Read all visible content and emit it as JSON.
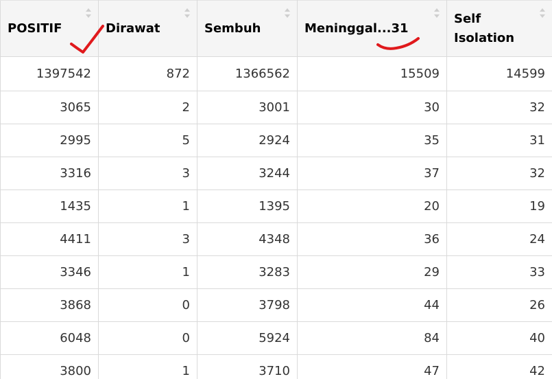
{
  "table": {
    "columns": [
      {
        "label": "POSITIF"
      },
      {
        "label": "Dirawat"
      },
      {
        "label": "Sembuh"
      },
      {
        "label": "Meninggal...31"
      },
      {
        "label": "Self Isolation"
      }
    ],
    "rows": [
      [
        "1397542",
        "872",
        "1366562",
        "15509",
        "14599"
      ],
      [
        "3065",
        "2",
        "3001",
        "30",
        "32"
      ],
      [
        "2995",
        "5",
        "2924",
        "35",
        "31"
      ],
      [
        "3316",
        "3",
        "3244",
        "37",
        "32"
      ],
      [
        "1435",
        "1",
        "1395",
        "20",
        "19"
      ],
      [
        "4411",
        "3",
        "4348",
        "36",
        "24"
      ],
      [
        "3346",
        "1",
        "3283",
        "29",
        "33"
      ],
      [
        "3868",
        "0",
        "3798",
        "44",
        "26"
      ],
      [
        "6048",
        "0",
        "5924",
        "84",
        "40"
      ],
      [
        "3800",
        "1",
        "3710",
        "47",
        "42"
      ]
    ]
  },
  "annotations": {
    "color": "#e0191c",
    "marks": [
      "checkmark",
      "underline-squiggle"
    ]
  }
}
